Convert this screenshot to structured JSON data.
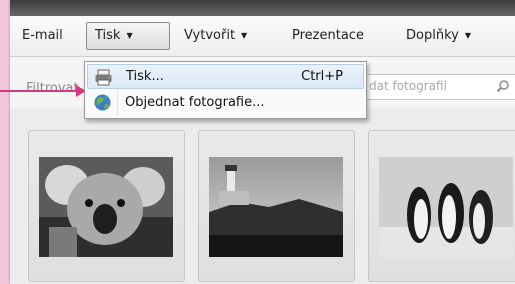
{
  "menubar": {
    "items": [
      {
        "label": "E-mail"
      },
      {
        "label": "Tisk"
      },
      {
        "label": "Vytvořit"
      },
      {
        "label": "Prezentace"
      },
      {
        "label": "Doplňky"
      }
    ]
  },
  "filter": {
    "label": "Filtrovat",
    "search_placeholder": "dat fotografii"
  },
  "dropdown": {
    "items": [
      {
        "label": "Tisk...",
        "shortcut": "Ctrl+P",
        "icon": "printer-icon"
      },
      {
        "label": "Objednat fotografie...",
        "icon": "globe-icon"
      }
    ]
  },
  "thumbnails": [
    {
      "subject": "koala",
      "icon": "koala-photo"
    },
    {
      "subject": "lighthouse",
      "icon": "lighthouse-photo"
    },
    {
      "subject": "penguins",
      "icon": "penguins-photo"
    }
  ],
  "colors": {
    "background": "#f3c6dc",
    "annotation_arrow": "#d6377e"
  }
}
